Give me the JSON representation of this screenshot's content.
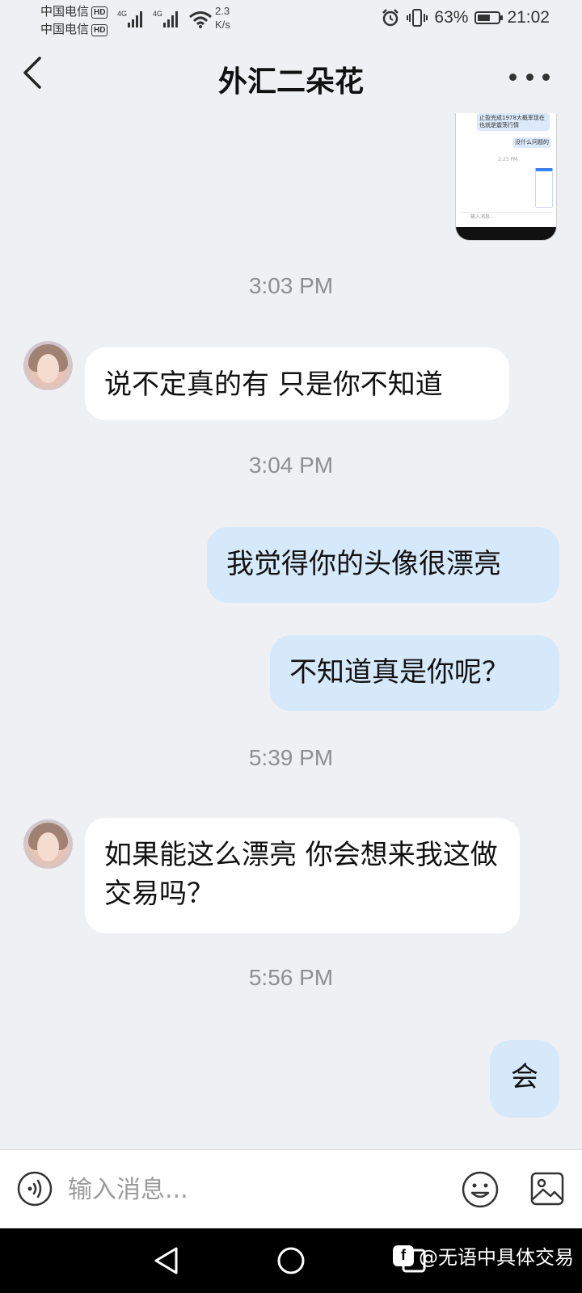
{
  "status_bar": {
    "carrier_1": "中国电信",
    "carrier_2": "中国电信",
    "hd_badge": "HD",
    "network_type_1": "4G",
    "network_type_2": "4G",
    "net_speed_value": "2.3",
    "net_speed_unit": "K/s",
    "battery_percent": "63%",
    "battery_level": 0.63,
    "time": "21:02",
    "icons": [
      "alarm-icon",
      "vibrate-icon",
      "wifi-icon",
      "signal-icon",
      "battery-icon"
    ]
  },
  "header": {
    "title": "外汇二朵花",
    "back_icon": "chevron-left-icon",
    "more_icon": "more-dots-icon"
  },
  "shared_image": {
    "text_1": "止盈完成1978大概率现在也就是震荡行情",
    "text_2": "没什么问题的",
    "time": "2:23 PM",
    "input_placeholder": "输入消息..."
  },
  "messages": [
    {
      "type": "timestamp",
      "text": "3:03 PM"
    },
    {
      "type": "incoming",
      "text": "说不定真的有 只是你不知道"
    },
    {
      "type": "timestamp",
      "text": "3:04 PM"
    },
    {
      "type": "outgoing",
      "text": "我觉得你的头像很漂亮"
    },
    {
      "type": "outgoing",
      "text": "不知道真是你呢？"
    },
    {
      "type": "timestamp",
      "text": "5:39 PM"
    },
    {
      "type": "incoming",
      "text": "如果能这么漂亮 你会想来我这做交易吗？"
    },
    {
      "type": "timestamp",
      "text": "5:56 PM"
    },
    {
      "type": "outgoing",
      "text": "会"
    }
  ],
  "input_bar": {
    "placeholder": "输入消息...",
    "voice_icon": "voice-icon",
    "emoji_icon": "emoji-icon",
    "image_icon": "image-icon"
  },
  "nav_bar": {
    "watermark_logo": "f",
    "watermark_text": "@无语中具体交易"
  },
  "colors": {
    "background": "#eff0f4",
    "incoming_bubble": "#ffffff",
    "outgoing_bubble": "#d6e9fb",
    "timestamp_text": "#8e8e93"
  }
}
